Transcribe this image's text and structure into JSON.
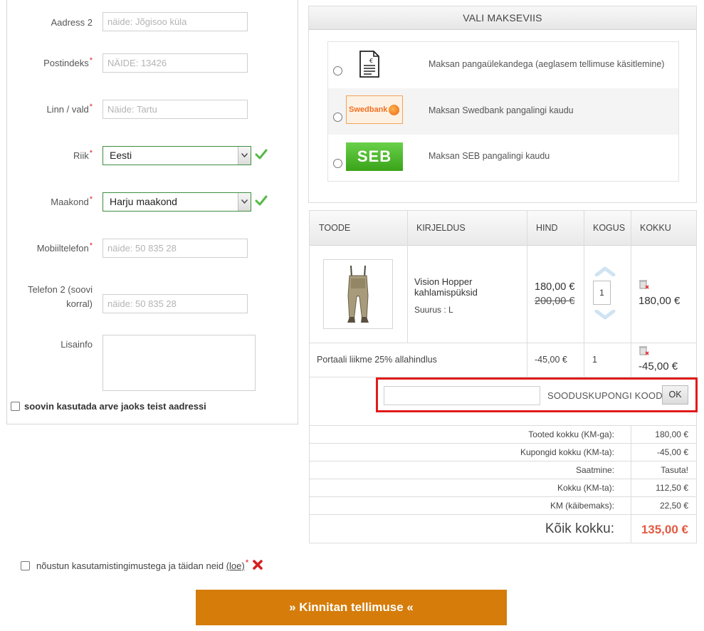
{
  "address_form": {
    "fields": [
      {
        "label": "Aadress 2",
        "required": false,
        "placeholder": "näide: Jõgisoo küla"
      },
      {
        "label": "Postindeks",
        "required": true,
        "placeholder": "NÄIDE: 13426"
      },
      {
        "label": "Linn / vald",
        "required": true,
        "placeholder": "Näide: Tartu"
      },
      {
        "label": "Riik",
        "required": true,
        "value": "Eesti"
      },
      {
        "label": "Maakond",
        "required": true,
        "value": "Harju maakond"
      },
      {
        "label": "Mobiiltelefon",
        "required": true,
        "placeholder": "näide: 50 835 28"
      },
      {
        "label_line1": "Telefon 2 (soovi",
        "label_line2": "korral)",
        "required": false,
        "placeholder": "näide: 50 835 28"
      },
      {
        "label": "Lisainfo",
        "required": false
      }
    ],
    "required_mark": "*",
    "alt_address_label": "soovin kasutada arve jaoks teist aadressi"
  },
  "payment": {
    "header": "VALI MAKSEVIIS",
    "options": [
      {
        "icon": "invoice-document-icon",
        "text": "Maksan pangaülekandega (aeglasem tellimuse käsitlemine)"
      },
      {
        "icon": "swedbank-logo",
        "logo_text": "Swedbank",
        "text": "Maksan Swedbank pangalingi kaudu"
      },
      {
        "icon": "seb-logo",
        "logo_text": "SEB",
        "text": "Maksan SEB pangalingi kaudu"
      }
    ]
  },
  "cart": {
    "headers": [
      "TOODE",
      "KIRJELDUS",
      "HIND",
      "KOGUS",
      "KOKKU"
    ],
    "item": {
      "name": "Vision Hopper kahlamispüksid",
      "size": "Suurus : L",
      "price": "180,00 €",
      "old_price": "200,00 €",
      "quantity": "1",
      "total": "180,00 €"
    },
    "discount": {
      "label": "Portaali liikme 25% allahindlus",
      "price": "-45,00 €",
      "quantity": "1",
      "total": "-45,00 €"
    },
    "coupon": {
      "label": "SOODUSKUPONGI KOOD",
      "button": "OK",
      "value": ""
    }
  },
  "totals": {
    "rows": [
      {
        "label": "Tooted kokku (KM-ga):",
        "value": "180,00 €"
      },
      {
        "label": "Kupongid kokku (KM-ta):",
        "value": "-45,00 €"
      },
      {
        "label": "Saatmine:",
        "value": "Tasuta!"
      },
      {
        "label": "Kokku (KM-ta):",
        "value": "112,50 €"
      },
      {
        "label": "KM (käibemaks):",
        "value": "22,50 €"
      }
    ],
    "grand_label": "Kõik kokku:",
    "grand_value": "135,00 €"
  },
  "terms": {
    "text": "nõustun kasutamistingimustega ja täidan neid",
    "link": "(loe)",
    "required_mark": "*"
  },
  "submit": {
    "label": "»  Kinnitan tellimuse  «"
  },
  "colors": {
    "accent": "#d57c0a",
    "error_red": "#e01b1b",
    "valid_green": "#3e8e3e",
    "grand_total": "#e35a42"
  }
}
